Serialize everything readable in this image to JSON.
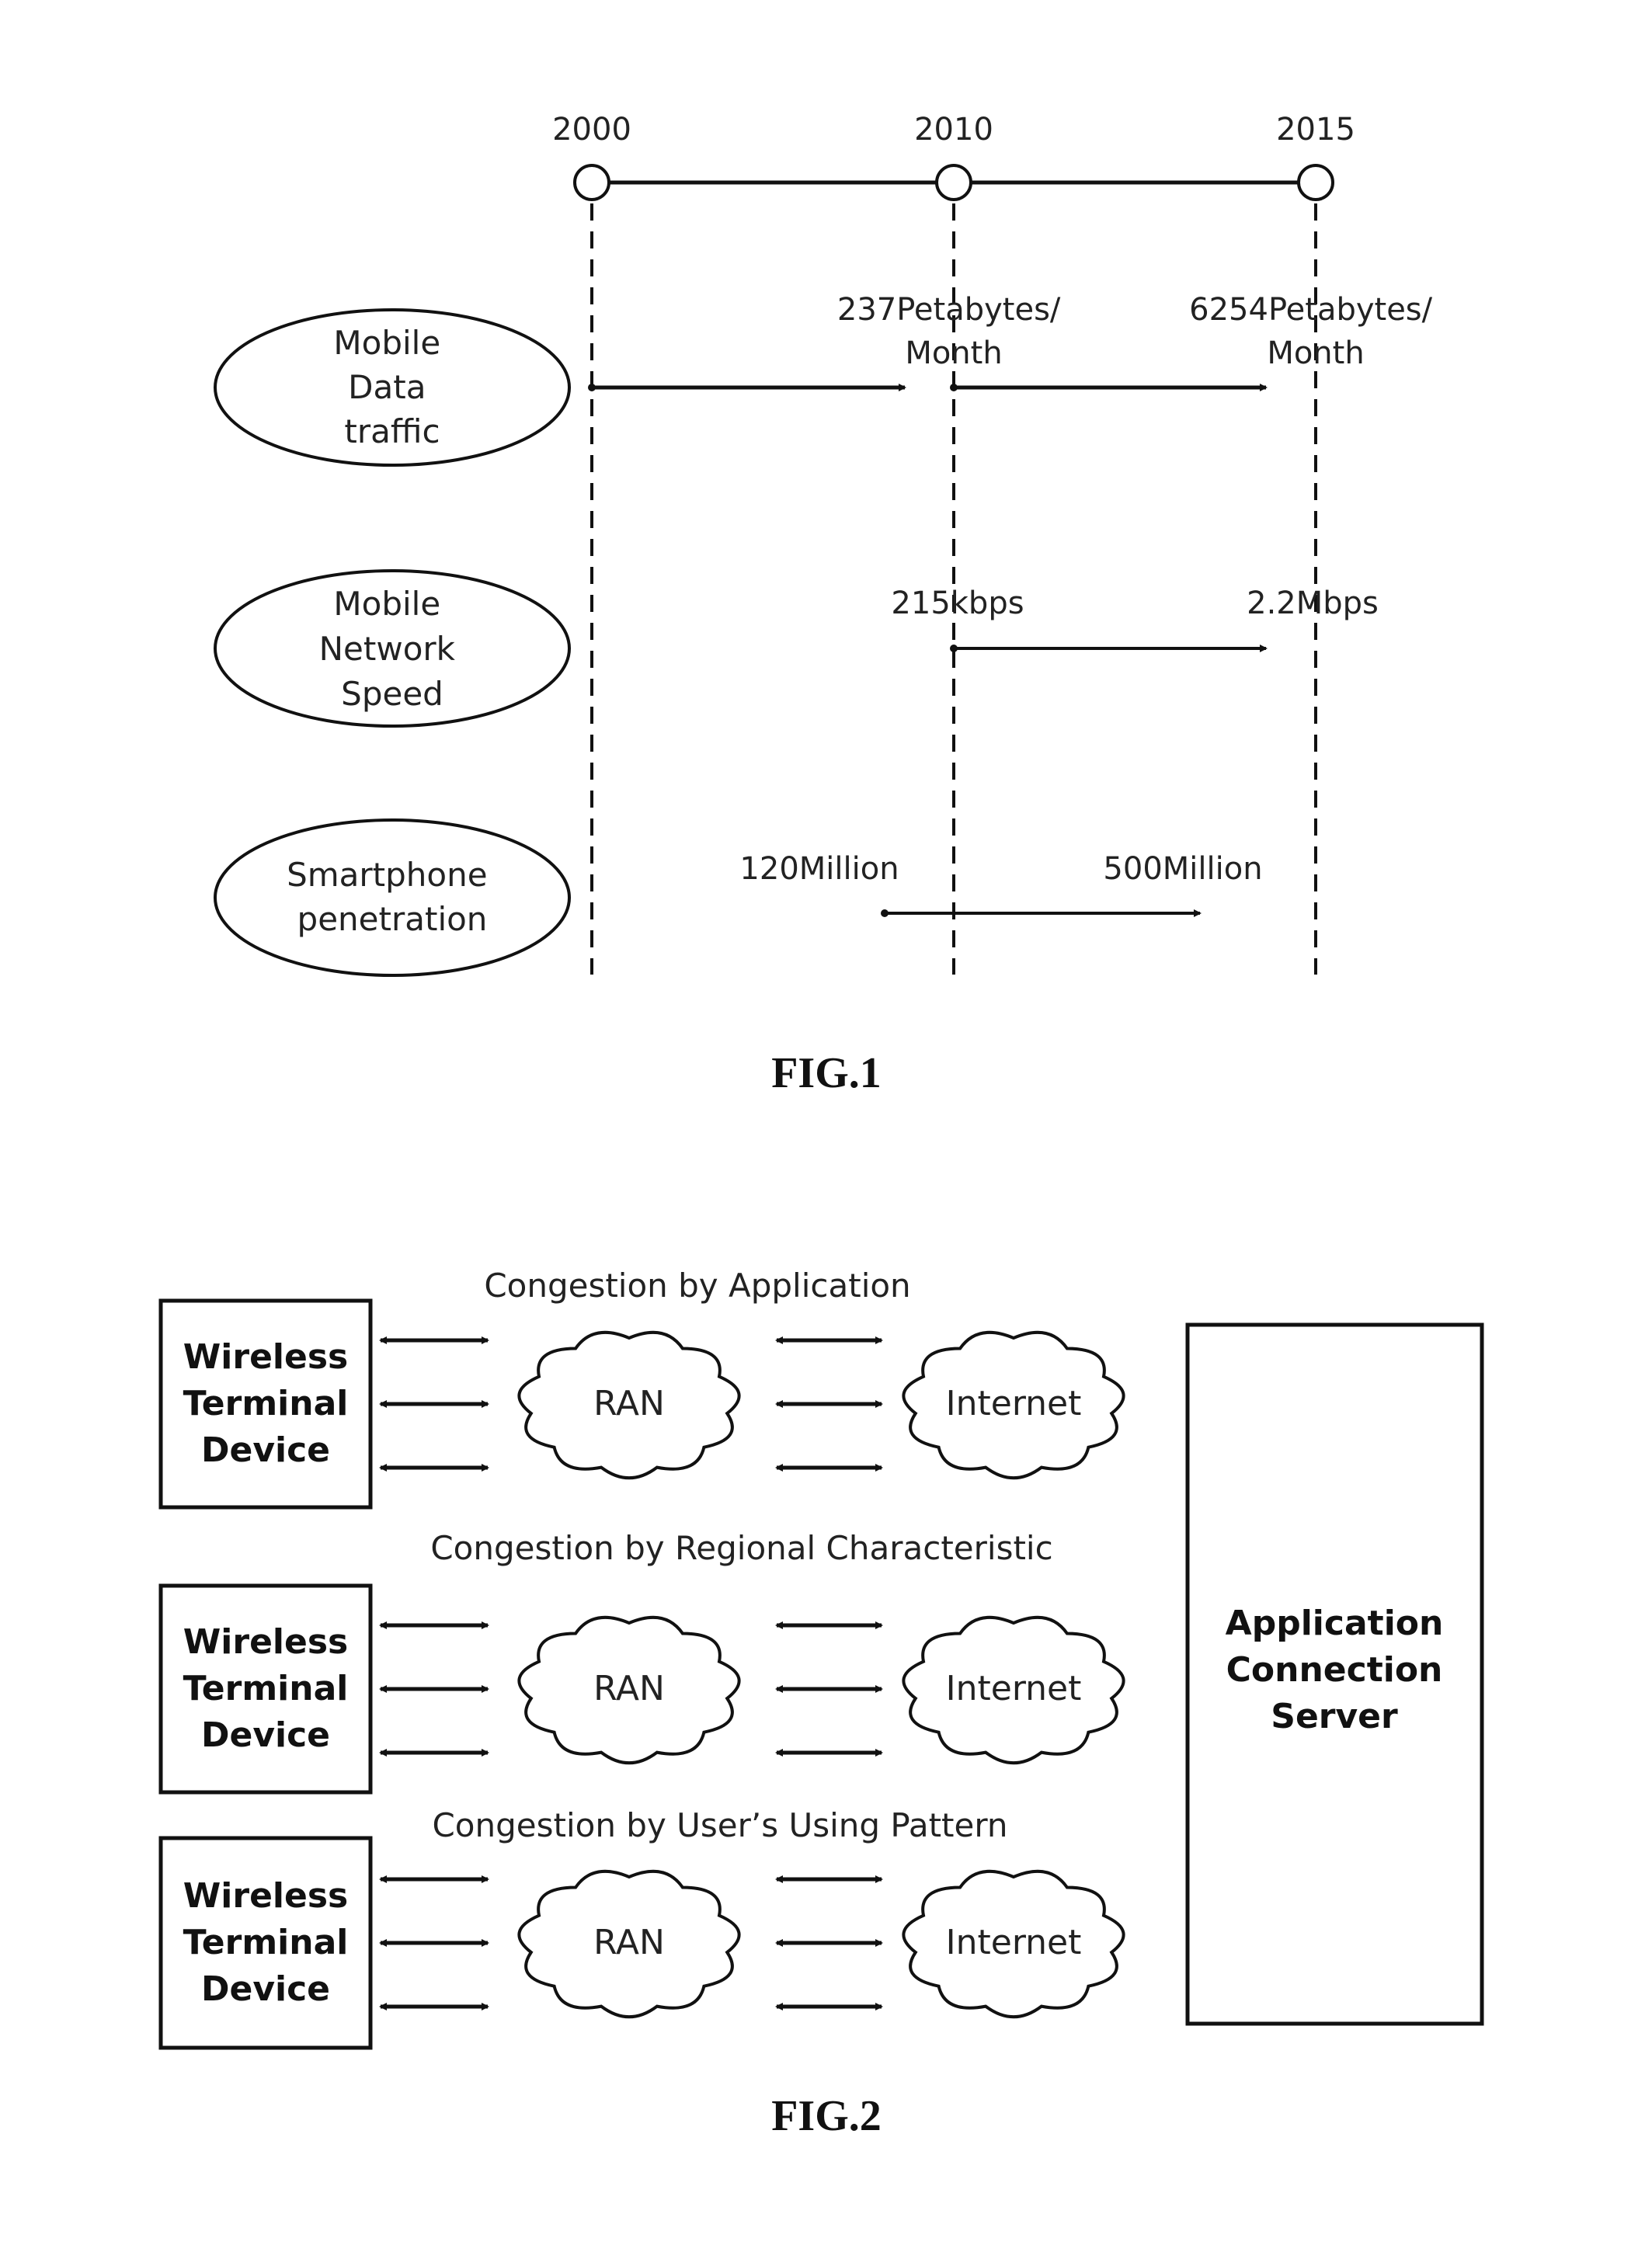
{
  "fig1": {
    "caption": "FIG.1",
    "years": [
      "2000",
      "2010",
      "2015"
    ],
    "rows": [
      {
        "label_lines": [
          "Mobile",
          "Data",
          "traffic"
        ],
        "value_2010_lines": [
          "237Petabytes/",
          "Month"
        ],
        "value_2015_lines": [
          "6254Petabytes/",
          "Month"
        ]
      },
      {
        "label_lines": [
          "Mobile",
          "Network",
          "Speed"
        ],
        "value_2010_lines": [
          "215kbps"
        ],
        "value_2015_lines": [
          "2.2Mbps"
        ]
      },
      {
        "label_lines": [
          "Smartphone",
          "penetration"
        ],
        "value_2010_lines": [
          "120Million"
        ],
        "value_2015_lines": [
          "500Million"
        ]
      }
    ]
  },
  "fig2": {
    "caption": "FIG.2",
    "server_lines": [
      "Application",
      "Connection",
      "Server"
    ],
    "terminal_lines": [
      "Wireless",
      "Terminal",
      "Device"
    ],
    "ran_label": "RAN",
    "internet_label": "Internet",
    "groups": [
      {
        "title": "Congestion by Application"
      },
      {
        "title": "Congestion by Regional Characteristic"
      },
      {
        "title": "Congestion by User’s Using Pattern"
      }
    ]
  }
}
